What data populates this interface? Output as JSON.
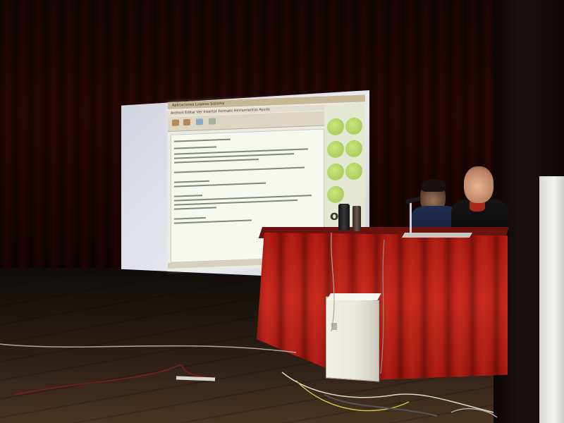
{
  "scene": {
    "description_tag": "stage presentation photo",
    "projected_window": {
      "topbar_text": "Aplicaciones  Lugares  Sistema",
      "menubar_text": "Archivo  Editar  Ver  Insertar  Formato  Herramientas  Ayuda"
    },
    "brand_text": "or",
    "colors": {
      "tablecloth": "#b51f15",
      "curtain": "#1a0505",
      "floor": "#3a281a",
      "screen": "#e2e4ea",
      "tower": "#ece9df"
    },
    "icons": [
      "projector-screen-icon",
      "microphone-icon",
      "computer-tower-icon"
    ]
  }
}
